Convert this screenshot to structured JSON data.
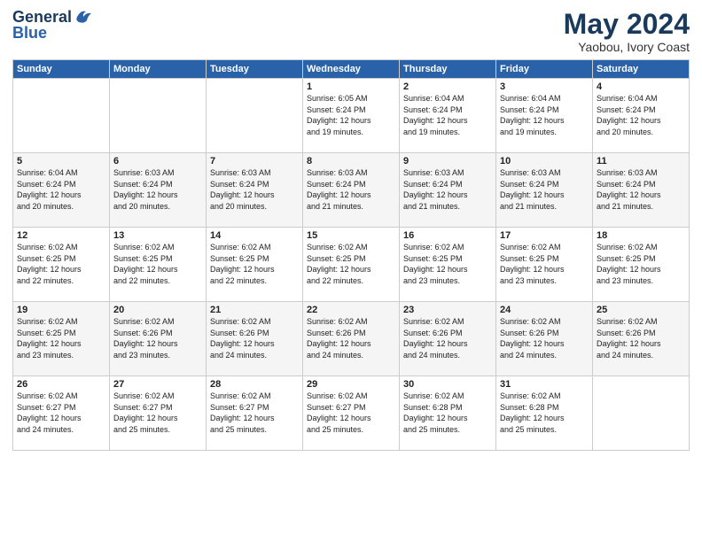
{
  "logo": {
    "line1": "General",
    "line2": "Blue"
  },
  "title": "May 2024",
  "subtitle": "Yaobou, Ivory Coast",
  "weekdays": [
    "Sunday",
    "Monday",
    "Tuesday",
    "Wednesday",
    "Thursday",
    "Friday",
    "Saturday"
  ],
  "weeks": [
    [
      {
        "day": "",
        "info": ""
      },
      {
        "day": "",
        "info": ""
      },
      {
        "day": "",
        "info": ""
      },
      {
        "day": "1",
        "info": "Sunrise: 6:05 AM\nSunset: 6:24 PM\nDaylight: 12 hours\nand 19 minutes."
      },
      {
        "day": "2",
        "info": "Sunrise: 6:04 AM\nSunset: 6:24 PM\nDaylight: 12 hours\nand 19 minutes."
      },
      {
        "day": "3",
        "info": "Sunrise: 6:04 AM\nSunset: 6:24 PM\nDaylight: 12 hours\nand 19 minutes."
      },
      {
        "day": "4",
        "info": "Sunrise: 6:04 AM\nSunset: 6:24 PM\nDaylight: 12 hours\nand 20 minutes."
      }
    ],
    [
      {
        "day": "5",
        "info": "Sunrise: 6:04 AM\nSunset: 6:24 PM\nDaylight: 12 hours\nand 20 minutes."
      },
      {
        "day": "6",
        "info": "Sunrise: 6:03 AM\nSunset: 6:24 PM\nDaylight: 12 hours\nand 20 minutes."
      },
      {
        "day": "7",
        "info": "Sunrise: 6:03 AM\nSunset: 6:24 PM\nDaylight: 12 hours\nand 20 minutes."
      },
      {
        "day": "8",
        "info": "Sunrise: 6:03 AM\nSunset: 6:24 PM\nDaylight: 12 hours\nand 21 minutes."
      },
      {
        "day": "9",
        "info": "Sunrise: 6:03 AM\nSunset: 6:24 PM\nDaylight: 12 hours\nand 21 minutes."
      },
      {
        "day": "10",
        "info": "Sunrise: 6:03 AM\nSunset: 6:24 PM\nDaylight: 12 hours\nand 21 minutes."
      },
      {
        "day": "11",
        "info": "Sunrise: 6:03 AM\nSunset: 6:24 PM\nDaylight: 12 hours\nand 21 minutes."
      }
    ],
    [
      {
        "day": "12",
        "info": "Sunrise: 6:02 AM\nSunset: 6:25 PM\nDaylight: 12 hours\nand 22 minutes."
      },
      {
        "day": "13",
        "info": "Sunrise: 6:02 AM\nSunset: 6:25 PM\nDaylight: 12 hours\nand 22 minutes."
      },
      {
        "day": "14",
        "info": "Sunrise: 6:02 AM\nSunset: 6:25 PM\nDaylight: 12 hours\nand 22 minutes."
      },
      {
        "day": "15",
        "info": "Sunrise: 6:02 AM\nSunset: 6:25 PM\nDaylight: 12 hours\nand 22 minutes."
      },
      {
        "day": "16",
        "info": "Sunrise: 6:02 AM\nSunset: 6:25 PM\nDaylight: 12 hours\nand 23 minutes."
      },
      {
        "day": "17",
        "info": "Sunrise: 6:02 AM\nSunset: 6:25 PM\nDaylight: 12 hours\nand 23 minutes."
      },
      {
        "day": "18",
        "info": "Sunrise: 6:02 AM\nSunset: 6:25 PM\nDaylight: 12 hours\nand 23 minutes."
      }
    ],
    [
      {
        "day": "19",
        "info": "Sunrise: 6:02 AM\nSunset: 6:25 PM\nDaylight: 12 hours\nand 23 minutes."
      },
      {
        "day": "20",
        "info": "Sunrise: 6:02 AM\nSunset: 6:26 PM\nDaylight: 12 hours\nand 23 minutes."
      },
      {
        "day": "21",
        "info": "Sunrise: 6:02 AM\nSunset: 6:26 PM\nDaylight: 12 hours\nand 24 minutes."
      },
      {
        "day": "22",
        "info": "Sunrise: 6:02 AM\nSunset: 6:26 PM\nDaylight: 12 hours\nand 24 minutes."
      },
      {
        "day": "23",
        "info": "Sunrise: 6:02 AM\nSunset: 6:26 PM\nDaylight: 12 hours\nand 24 minutes."
      },
      {
        "day": "24",
        "info": "Sunrise: 6:02 AM\nSunset: 6:26 PM\nDaylight: 12 hours\nand 24 minutes."
      },
      {
        "day": "25",
        "info": "Sunrise: 6:02 AM\nSunset: 6:26 PM\nDaylight: 12 hours\nand 24 minutes."
      }
    ],
    [
      {
        "day": "26",
        "info": "Sunrise: 6:02 AM\nSunset: 6:27 PM\nDaylight: 12 hours\nand 24 minutes."
      },
      {
        "day": "27",
        "info": "Sunrise: 6:02 AM\nSunset: 6:27 PM\nDaylight: 12 hours\nand 25 minutes."
      },
      {
        "day": "28",
        "info": "Sunrise: 6:02 AM\nSunset: 6:27 PM\nDaylight: 12 hours\nand 25 minutes."
      },
      {
        "day": "29",
        "info": "Sunrise: 6:02 AM\nSunset: 6:27 PM\nDaylight: 12 hours\nand 25 minutes."
      },
      {
        "day": "30",
        "info": "Sunrise: 6:02 AM\nSunset: 6:28 PM\nDaylight: 12 hours\nand 25 minutes."
      },
      {
        "day": "31",
        "info": "Sunrise: 6:02 AM\nSunset: 6:28 PM\nDaylight: 12 hours\nand 25 minutes."
      },
      {
        "day": "",
        "info": ""
      }
    ]
  ]
}
